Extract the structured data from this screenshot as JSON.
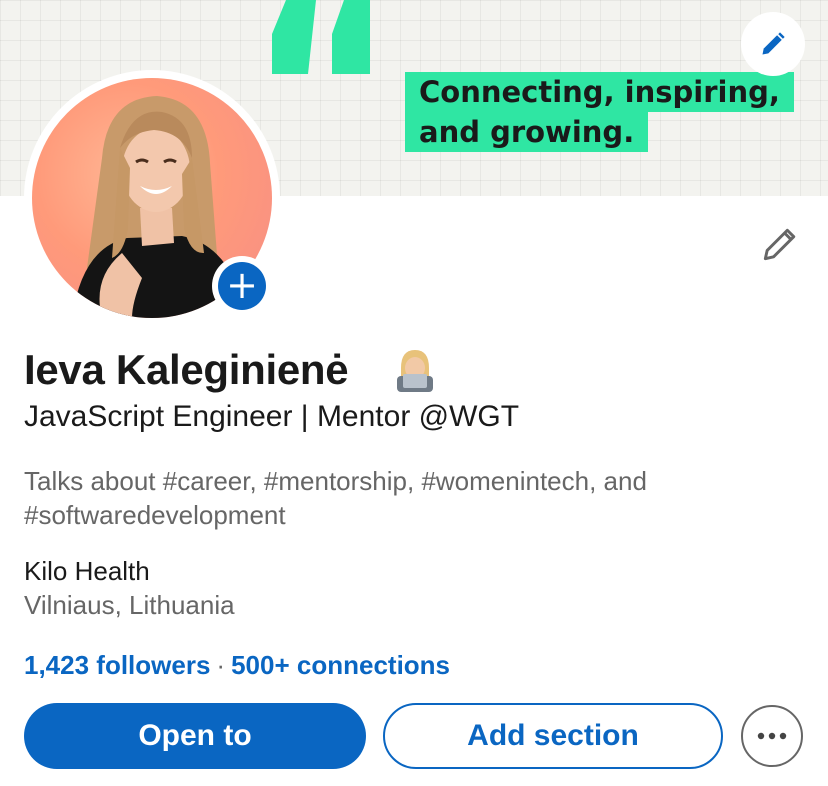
{
  "banner": {
    "tagline_line1": "Connecting, inspiring,",
    "tagline_line2": "and growing.",
    "accent_color": "#2fe6a3",
    "edit_icon": "pencil-icon"
  },
  "profile": {
    "name": "Ieva Kaleginienė",
    "headline": "JavaScript Engineer | Mentor @WGT",
    "talks_about": "Talks about #career, #mentorship, #womenintech, and #softwaredevelopment",
    "company": "Kilo Health",
    "location": "Vilniaus, Lithuania",
    "followers": "1,423 followers",
    "separator": "·",
    "connections": "500+ connections"
  },
  "actions": {
    "open_to": "Open to",
    "add_section": "Add section",
    "more_icon": "more-options-icon"
  },
  "colors": {
    "primary": "#0a66c2",
    "text": "#1a1a1a",
    "muted": "#666666"
  }
}
